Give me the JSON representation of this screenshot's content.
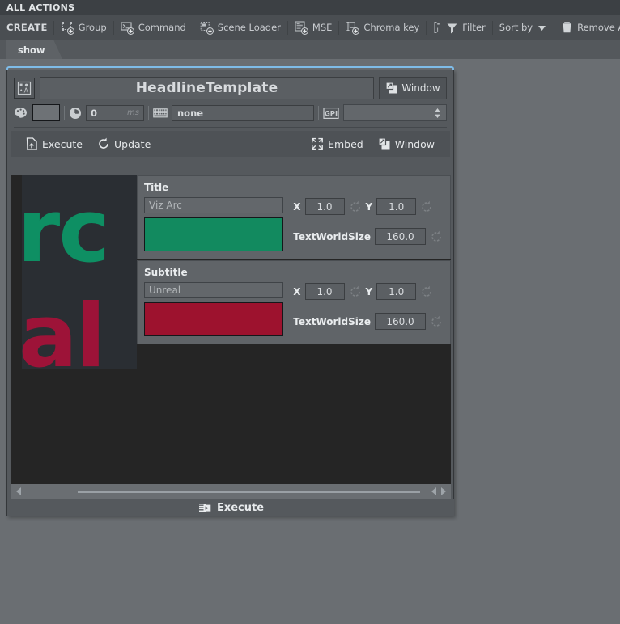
{
  "titlebar": {
    "title": "ALL ACTIONS"
  },
  "toolbar": {
    "create_label": "CREATE",
    "items": [
      {
        "label": "Group",
        "icon": "group-add-icon"
      },
      {
        "label": "Command",
        "icon": "command-add-icon"
      },
      {
        "label": "Scene Loader",
        "icon": "scene-loader-add-icon"
      },
      {
        "label": "MSE",
        "icon": "mse-add-icon"
      },
      {
        "label": "Chroma key",
        "icon": "chroma-key-add-icon"
      }
    ],
    "filter_label": "Filter",
    "sort_label": "Sort by",
    "remove_all_label": "Remove All"
  },
  "tabs": [
    {
      "label": "show",
      "active": true
    }
  ],
  "action": {
    "name": "HeadlineTemplate",
    "window_label": "Window",
    "color_swatch": "#6e7276",
    "delay_value": "0",
    "delay_unit": "ms",
    "shortcut_value": "none",
    "gpi_value": "",
    "execute_label": "Execute",
    "update_label": "Update",
    "embed_label": "Embed",
    "window_label2": "Window",
    "footer_execute_label": "Execute"
  },
  "preview": {
    "glyph_top": "rc",
    "glyph_bottom": "al",
    "glyph_top_color": "#0e8f63",
    "glyph_bottom_color": "#9d1338",
    "background": "#2a2e33"
  },
  "sections": [
    {
      "title": "Title",
      "text_value": "Viz Arc",
      "color": "#128a5f",
      "x_label": "X",
      "x_value": "1.0",
      "y_label": "Y",
      "y_value": "1.0",
      "tws_label": "TextWorldSize",
      "tws_value": "160.0"
    },
    {
      "title": "Subtitle",
      "text_value": "Unreal",
      "color": "#9d122e",
      "x_label": "X",
      "x_value": "1.0",
      "y_label": "Y",
      "y_value": "1.0",
      "tws_label": "TextWorldSize",
      "tws_value": "160.0"
    }
  ]
}
